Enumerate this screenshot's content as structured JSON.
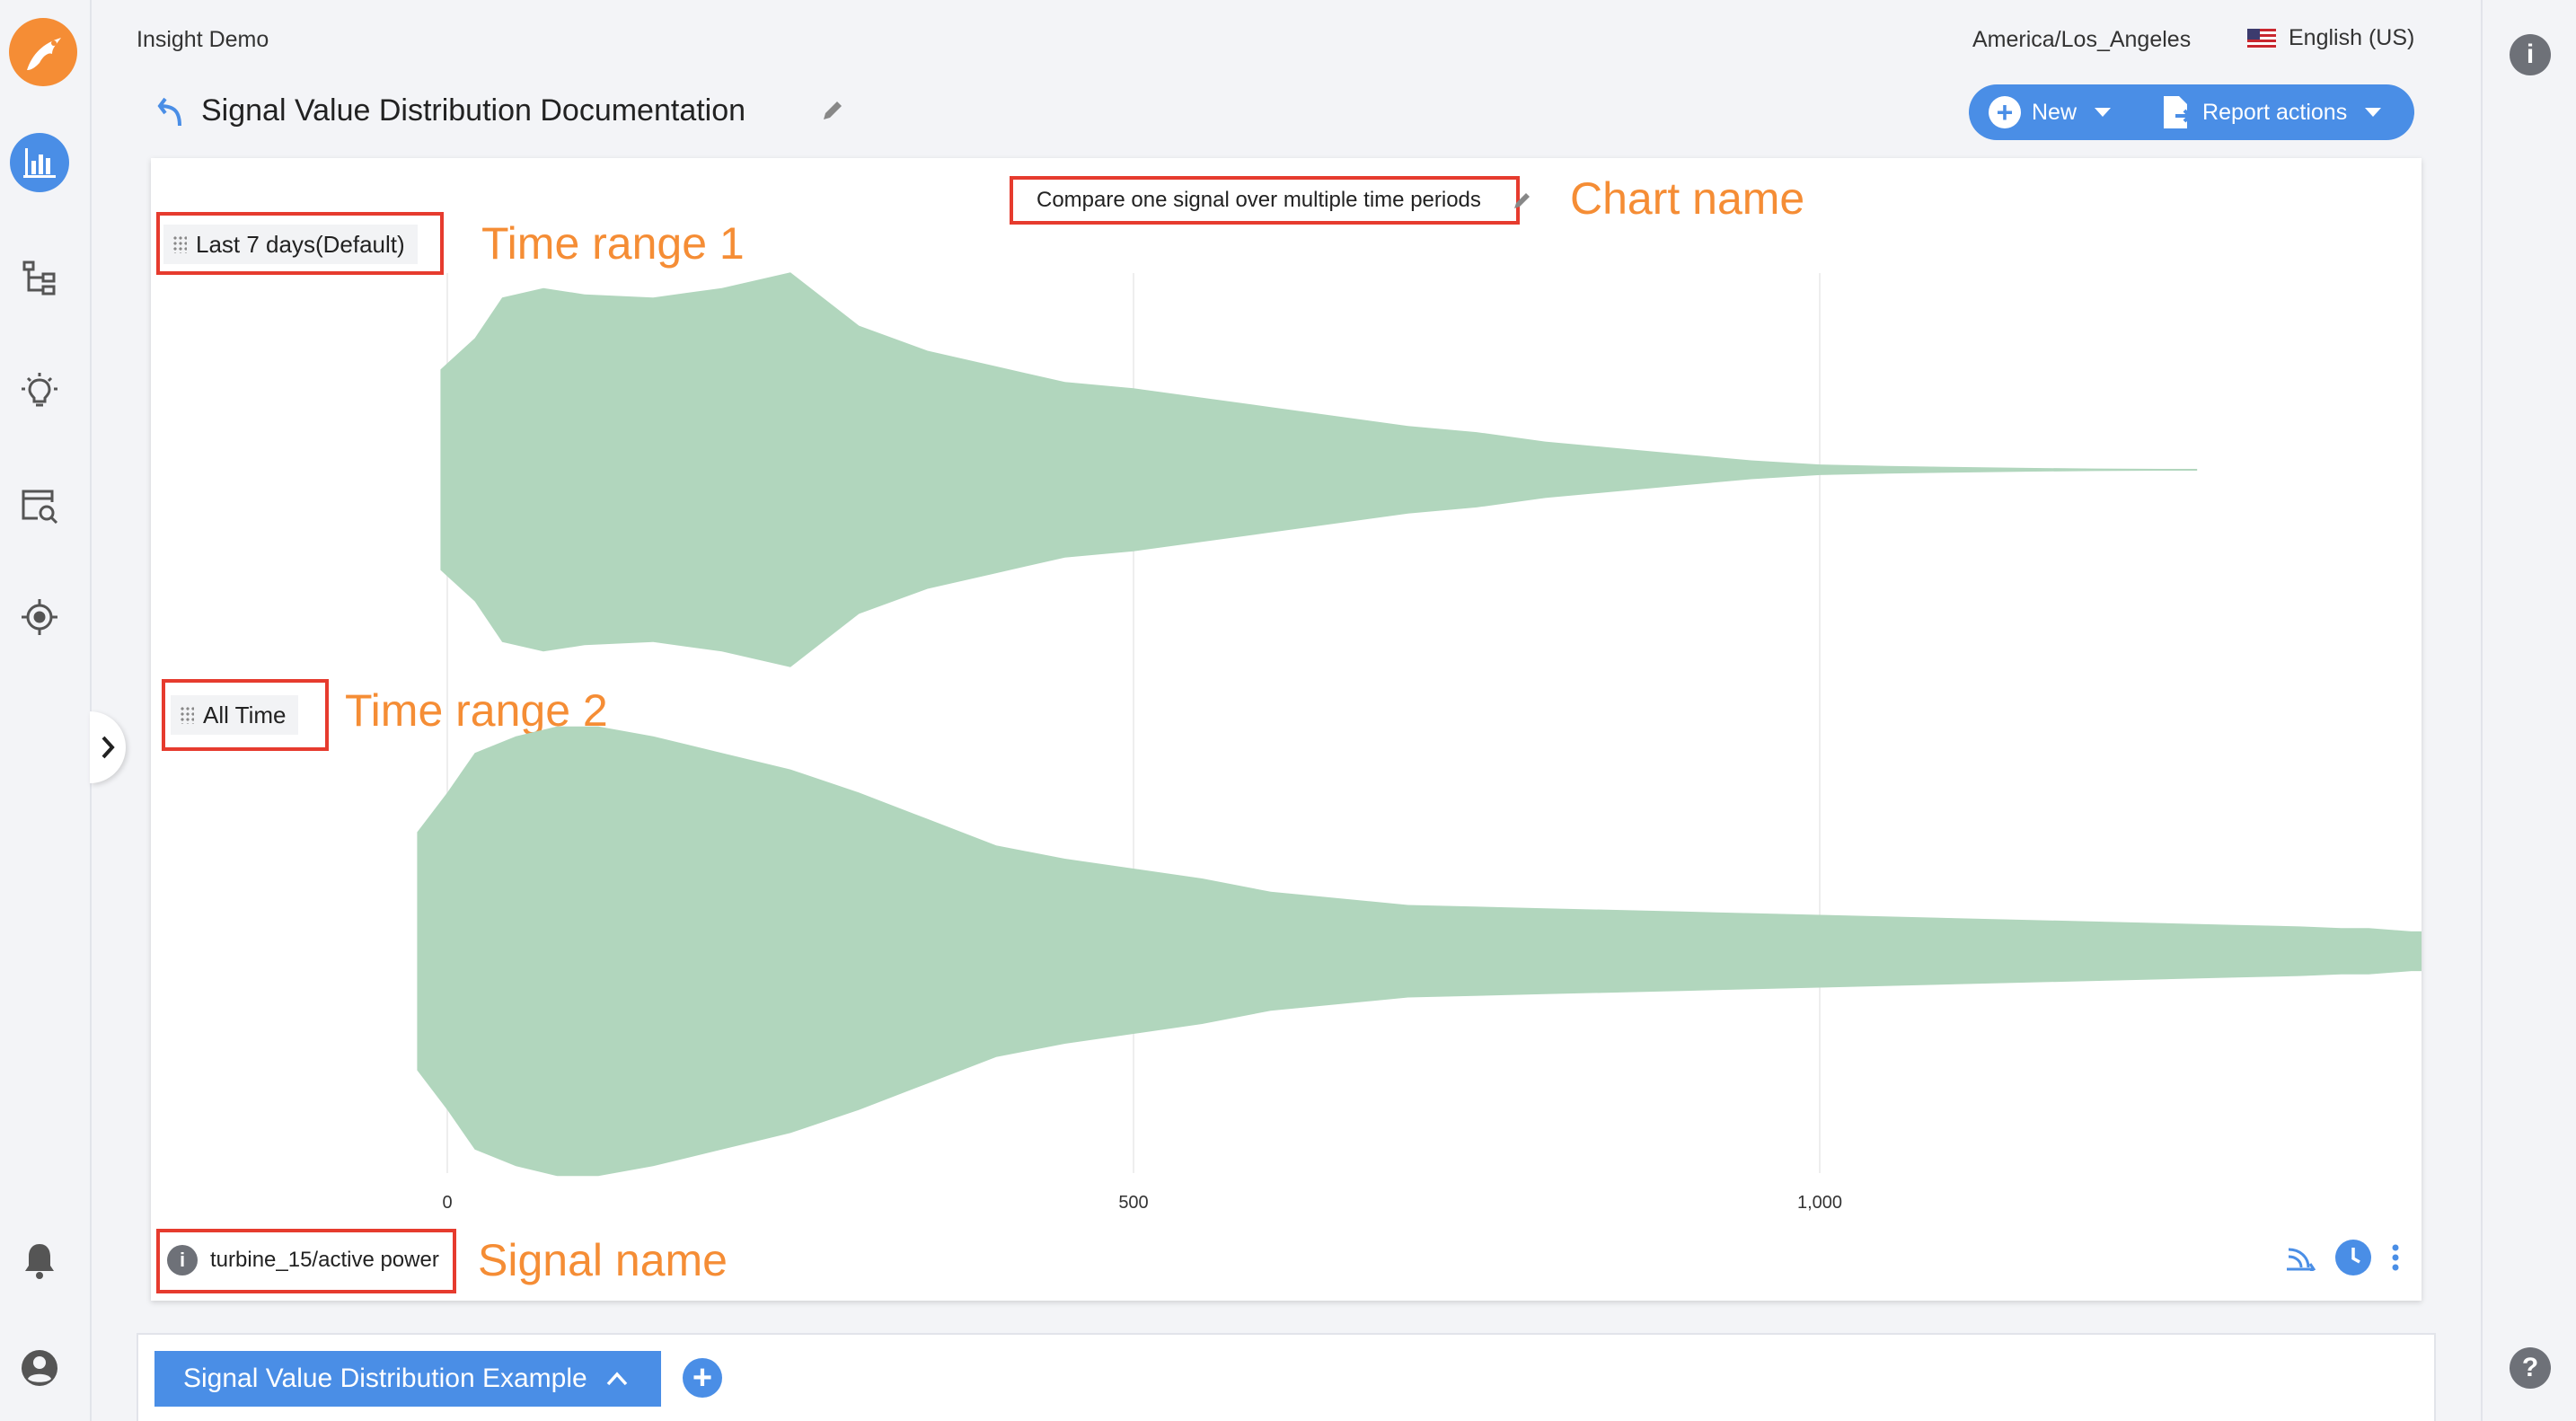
{
  "app": {
    "workspace_name": "Insight Demo",
    "timezone": "America/Los_Angeles",
    "language": "English (US)"
  },
  "report": {
    "title": "Signal Value Distribution Documentation",
    "new_label": "New",
    "actions_label": "Report actions"
  },
  "chart": {
    "name": "Compare one signal over multiple time periods",
    "time_ranges": [
      "Last 7 days(Default)",
      "All Time"
    ],
    "signal_name": "turbine_15/active power",
    "x_ticks": [
      "0",
      "500",
      "1,000"
    ]
  },
  "annotations": {
    "chart_name": "Chart name",
    "time_range_1": "Time range 1",
    "time_range_2": "Time range 2",
    "signal_name": "Signal name"
  },
  "chart_data": {
    "type": "area",
    "x_ticks": [
      0,
      500,
      1000
    ],
    "xlim": [
      -22,
      1440
    ],
    "fill_color": "#b1d6bd",
    "series": [
      {
        "x": [
          -5,
          0,
          20,
          40,
          70,
          100,
          150,
          200,
          250,
          300,
          350,
          400,
          450,
          500,
          550,
          600,
          650,
          700,
          750,
          800,
          850,
          900,
          950,
          1000,
          1050,
          1100,
          1150,
          1200,
          1250,
          1275
        ],
        "y": [
          0.32,
          0.34,
          0.42,
          0.55,
          0.58,
          0.56,
          0.55,
          0.58,
          0.63,
          0.46,
          0.38,
          0.33,
          0.28,
          0.26,
          0.23,
          0.2,
          0.17,
          0.14,
          0.12,
          0.09,
          0.07,
          0.05,
          0.03,
          0.017,
          0.012,
          0.009,
          0.006,
          0.004,
          0.003,
          0.003
        ]
      },
      {
        "x": [
          -22,
          0,
          10,
          20,
          50,
          80,
          110,
          150,
          200,
          250,
          300,
          350,
          400,
          450,
          500,
          550,
          600,
          700,
          800,
          900,
          1000,
          1100,
          1200,
          1300,
          1350,
          1380,
          1400,
          1431,
          1440
        ],
        "y": [
          0.36,
          0.48,
          0.54,
          0.6,
          0.65,
          0.68,
          0.68,
          0.65,
          0.6,
          0.55,
          0.48,
          0.4,
          0.32,
          0.28,
          0.25,
          0.22,
          0.18,
          0.14,
          0.13,
          0.12,
          0.11,
          0.1,
          0.09,
          0.08,
          0.075,
          0.07,
          0.07,
          0.06,
          0.06
        ]
      }
    ]
  }
}
